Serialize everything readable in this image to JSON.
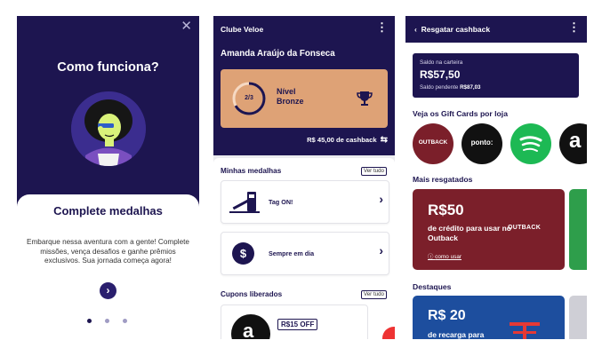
{
  "screen1": {
    "title": "Como funciona?",
    "sheet_title": "Complete medalhas",
    "description": "Embarque nessa aventura com a gente! Complete missões, vença desafios e ganhe prêmios exclusivos. Sua jornada começa agora!",
    "close_icon": "close-icon",
    "next_icon": "chevron-right-icon",
    "page_indicator": {
      "total": 3,
      "active": 1
    }
  },
  "screen2": {
    "header": "Clube Veloe",
    "user_name": "Amanda Araújo da Fonseca",
    "level": {
      "progress": "2/3",
      "name_line1": "Nível",
      "name_line2": "Bronze",
      "progress_fraction": 0.67
    },
    "cashback": "R$ 45,00 de cashback",
    "medals_title": "Minhas medalhas",
    "see_all": "Ver tudo",
    "medals": [
      {
        "label": "Tag ON!",
        "icon": "toll-gate-icon"
      },
      {
        "label": "Sempre em dia",
        "icon": "dollar-icon"
      }
    ],
    "coupons_title": "Cupons liberados",
    "coupons_see_all": "Ver tudo",
    "coupon": {
      "value": "R$15 OFF",
      "icon": "amazon-icon"
    },
    "colors": {
      "primary": "#1d1550",
      "level_card": "#dea276"
    }
  },
  "screen3": {
    "header": "Resgatar cashback",
    "wallet": {
      "label": "Saldo na carteira",
      "balance": "R$57,50",
      "pending_label": "Saldo pendente",
      "pending_value": "R$87,03"
    },
    "giftcards_title": "Veja os Gift Cards por loja",
    "stores": [
      {
        "name": "OUTBACK",
        "color": "#7b1f2a"
      },
      {
        "name": "ponto:",
        "color": "#111111"
      },
      {
        "name": "spotify",
        "color": "#1db954"
      },
      {
        "name": "amazon",
        "color": "#111111"
      }
    ],
    "popular_title": "Mais resgatados",
    "popular": {
      "amount": "R$50",
      "text": "de crédito para usar no Outback",
      "howto": "como usar",
      "brand": "OUTBACK"
    },
    "highlights_title": "Destaques",
    "highlight": {
      "amount": "R$ 20",
      "text": "de recarga para"
    }
  }
}
